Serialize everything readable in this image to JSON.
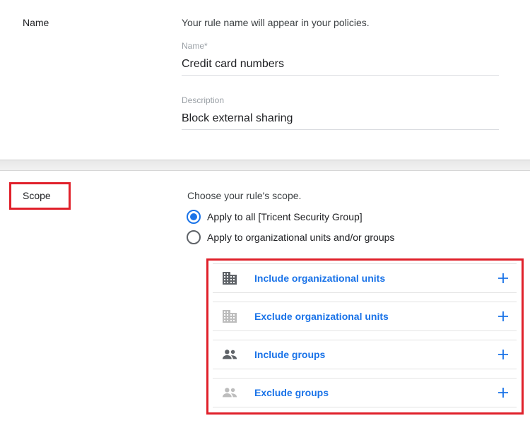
{
  "name_section": {
    "label": "Name",
    "hint": "Your rule name will appear in your policies.",
    "name_field": {
      "label": "Name*",
      "value": "Credit card numbers"
    },
    "description_field": {
      "label": "Description",
      "value": "Block external sharing"
    }
  },
  "scope_section": {
    "label": "Scope",
    "hint": "Choose your rule's scope.",
    "options": [
      {
        "label": "Apply to all [Tricent Security Group]",
        "checked": true
      },
      {
        "label": "Apply to organizational units and/or groups",
        "checked": false
      }
    ],
    "list": [
      {
        "label": "Include organizational units",
        "icon": "building-icon"
      },
      {
        "label": "Exclude organizational units",
        "icon": "building-icon"
      },
      {
        "label": "Include groups",
        "icon": "people-icon"
      },
      {
        "label": "Exclude groups",
        "icon": "people-icon"
      }
    ]
  },
  "colors": {
    "accent": "#1a73e8",
    "highlight": "#e0202a"
  }
}
